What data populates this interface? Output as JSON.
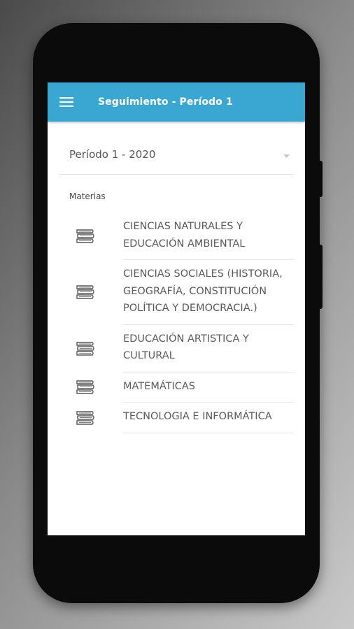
{
  "app_bar": {
    "title": "Seguimiento - Período 1",
    "menu_icon": "hamburger-menu-icon",
    "background": "#3aa7d3"
  },
  "period_select": {
    "value": "Período 1 - 2020",
    "icon": "dropdown-arrow-icon"
  },
  "section_label": "Materias",
  "subjects": [
    {
      "name": "CIENCIAS NATURALES Y EDUCACIÓN AMBIENTAL",
      "icon": "books-icon"
    },
    {
      "name": "CIENCIAS SOCIALES (HISTORIA, GEOGRAFÍA, CONSTITUCIÓN POLÍTICA Y DEMOCRACIA.)",
      "icon": "books-icon"
    },
    {
      "name": "EDUCACIÓN ARTISTICA Y CULTURAL",
      "icon": "books-icon"
    },
    {
      "name": "MATEMÁTICAS",
      "icon": "books-icon"
    },
    {
      "name": "TECNOLOGIA E INFORMÁTICA",
      "icon": "books-icon"
    }
  ]
}
